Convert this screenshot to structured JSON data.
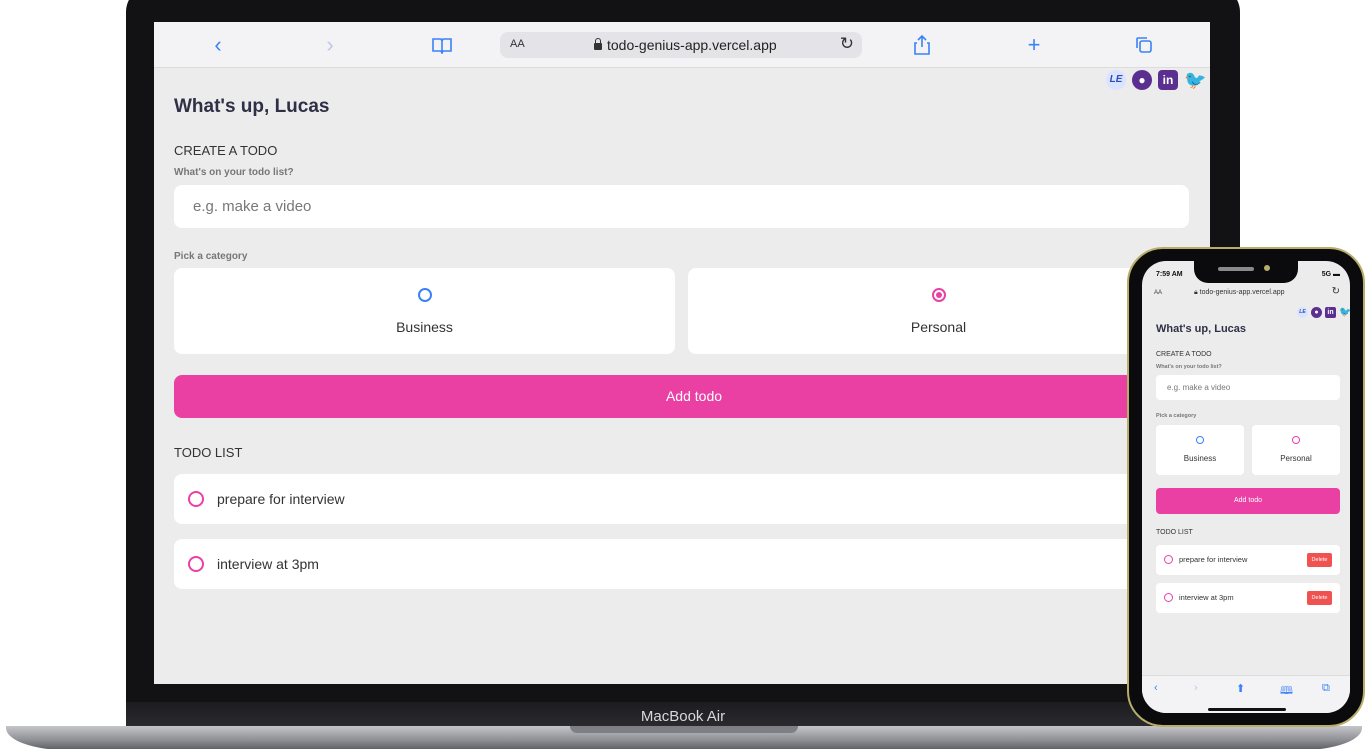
{
  "laptop": {
    "model_label": "MacBook Air",
    "browser": {
      "back_icon": "chevron-left-icon",
      "forward_icon": "chevron-right-icon",
      "text_size": "AA",
      "url": "todo-genius-app.vercel.app"
    },
    "page": {
      "social_links": [
        "LE",
        "github",
        "linkedin",
        "twitter"
      ],
      "greeting": "What's up, Lucas",
      "create_heading": "CREATE A TODO",
      "input_label": "What's on your todo list?",
      "input_placeholder": "e.g. make a video",
      "category_label": "Pick a category",
      "categories": [
        {
          "label": "Business",
          "selected": false
        },
        {
          "label": "Personal",
          "selected": true
        }
      ],
      "add_button": "Add todo",
      "list_heading": "TODO LIST",
      "todos": [
        {
          "text": "prepare for interview",
          "done": false
        },
        {
          "text": "interview at 3pm",
          "done": false
        }
      ]
    }
  },
  "phone": {
    "status": {
      "time": "7:59 AM",
      "signal": "5G"
    },
    "browser": {
      "text_size": "AA",
      "url": "todo-genius-app.vercel.app"
    },
    "page": {
      "greeting": "What's up, Lucas",
      "create_heading": "CREATE A TODO",
      "input_label": "What's on your todo list?",
      "input_placeholder": "e.g. make a video",
      "category_label": "Pick a category",
      "categories": [
        {
          "label": "Business",
          "selected": false
        },
        {
          "label": "Personal",
          "selected": false
        }
      ],
      "add_button": "Add todo",
      "list_heading": "TODO LIST",
      "todos": [
        {
          "text": "prepare for interview",
          "delete_label": "Delete"
        },
        {
          "text": "interview at 3pm",
          "delete_label": "Delete"
        }
      ]
    }
  },
  "colors": {
    "accent_pink": "#ea40a4",
    "accent_blue": "#3b82f6",
    "delete_red": "#f05252",
    "social_purple": "#5b2f8f"
  }
}
